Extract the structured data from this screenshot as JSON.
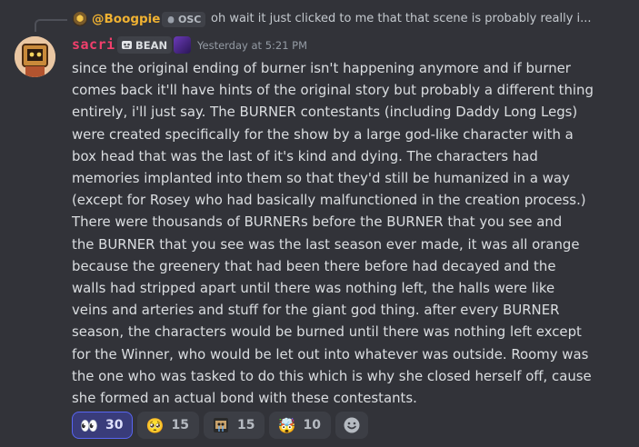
{
  "reply": {
    "author": "@Boogpie",
    "tag": "OSC",
    "content": "oh wait it just clicked to me that that scene is probably really i..."
  },
  "message": {
    "author": "sacri",
    "server_tag": "BEAN",
    "timestamp": "Yesterday at 5:21 PM",
    "lines": [
      "since the original ending of burner isn't happening anymore and if burner",
      "comes back it'll have hints of the original story but probably a different thing",
      "entirely, i'll just say. The BURNER contestants (including Daddy Long Legs)",
      "were created specifically for the show by a large god-like character with a",
      "box head that was the last of it's kind and dying. The characters had",
      "memories implanted into them so that they'd still be humanized in a way",
      "(except for Rosey who had basically malfunctioned in the creation process.)",
      "There were thousands of BURNERs before the BURNER that you see and",
      "the BURNER that you see was the last season ever made, it was all orange",
      "because the greenery that had been there before had decayed and the",
      "walls had stripped apart until there was nothing left, the halls were like",
      "veins and arteries and stuff for the giant god thing. after every BURNER",
      "season, the characters would be burned until there was nothing left except",
      "for the Winner, who would be let out into whatever was outside. Roomy was",
      "the one who was tasked to do this which is why she closed herself off, cause",
      "she formed an actual bond with these contestants."
    ]
  },
  "reactions": [
    {
      "emoji": "eyes-emoji",
      "glyph": "👀",
      "count": "30",
      "active": true
    },
    {
      "emoji": "pleading-face-emoji",
      "glyph": "🥺",
      "count": "15",
      "active": false
    },
    {
      "emoji": "custom-crying-emoji",
      "glyph": "",
      "count": "15",
      "active": false
    },
    {
      "emoji": "exploding-head-emoji",
      "glyph": "🤯",
      "count": "10",
      "active": false
    }
  ],
  "colors": {
    "background": "#323339",
    "author": "#f23f6c",
    "reply_author": "#f0b232",
    "reaction_active_border": "#5865f2"
  }
}
